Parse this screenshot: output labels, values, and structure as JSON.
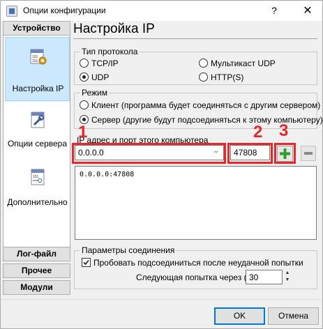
{
  "window": {
    "title": "Опции конфигурации",
    "help": "?",
    "close": "✕"
  },
  "categories": {
    "device": "Устройство",
    "log_file": "Лог-файл",
    "other": "Прочее",
    "modules": "Модули"
  },
  "nav": [
    {
      "label": "Настройка IP",
      "icon": "network-config-icon",
      "selected": true
    },
    {
      "label": "Опции сервера",
      "icon": "server-options-icon",
      "selected": false
    },
    {
      "label": "Дополнительно",
      "icon": "additional-icon",
      "selected": false
    }
  ],
  "main": {
    "title": "Настройка IP",
    "protocol": {
      "legend": "Тип протокола",
      "tcp": "TCP/IP",
      "udp": "UDP",
      "multicast": "Мультикаст UDP",
      "http": "HTTP(S)",
      "selected": "UDP"
    },
    "mode": {
      "legend": "Режим",
      "client": "Клиент (программа будет соединяться с другим сервером)",
      "server": "Сервер (другие будут подсоединяться к этому компьютеру)",
      "selected": "server"
    },
    "ip": {
      "label": "IP адрес и порт этого компьютера",
      "address": "0.0.0.0",
      "port": "47808",
      "list": [
        "0.0.0.0:47808"
      ]
    },
    "annotations": {
      "one": "1",
      "two": "2",
      "three": "3"
    },
    "connection": {
      "legend": "Параметры соединения",
      "retry_check": "Пробовать подсоединиться после неудачной попытки",
      "retry_checked": true,
      "next_try_label": "Следующая попытка через (с)",
      "next_try_value": "30"
    }
  },
  "footer": {
    "ok": "OK",
    "cancel": "Отмена"
  },
  "colors": {
    "annotation": "#e8262b",
    "add_plus": "#2e9e2e",
    "selection": "#cce8ff"
  }
}
